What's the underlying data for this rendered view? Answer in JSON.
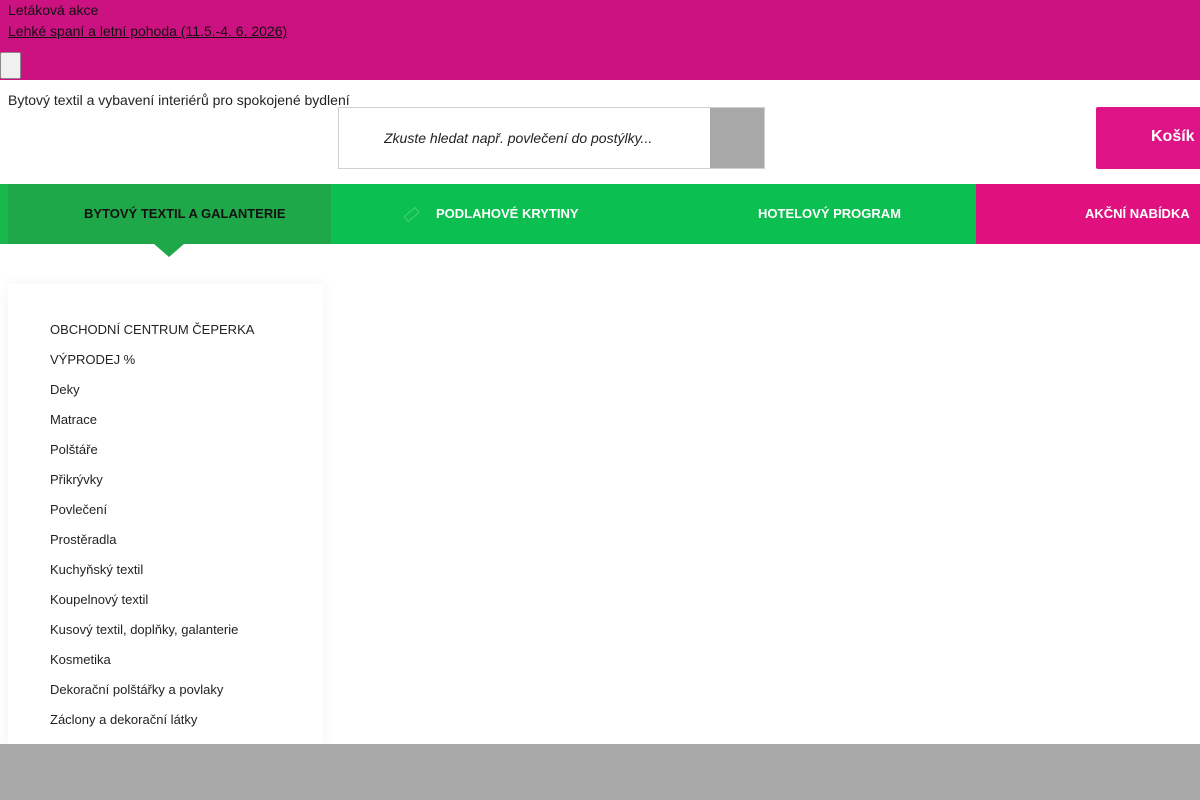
{
  "promo": {
    "title": "Letáková akce",
    "link_text": "Lehké spaní a letní pohoda (11.5.-4. 6. 2026)",
    "close_icon": "close-icon"
  },
  "header": {
    "logo_alt": "Bytový textil a vybavení interiérů pro spokojené bydlení",
    "search": {
      "placeholder": "Zkuste hledat např. povlečení do postýlky...",
      "value": "",
      "icon": "search-icon",
      "button_icon": "search-submit-icon",
      "icon_glyph": "",
      "button_glyph": ""
    },
    "cart": {
      "label": "Košík",
      "icon": "cart-icon",
      "icon_glyph": ""
    }
  },
  "nav": {
    "items": [
      {
        "label": "Bytový textil a galanterie",
        "icon": "home-icon",
        "glyph": "",
        "active": true
      },
      {
        "label": "Podlahové krytiny",
        "icon": "ruler-icon",
        "glyph": "▭"
      },
      {
        "label": "Hotelový program",
        "icon": "building-icon",
        "glyph": ""
      },
      {
        "label": "Akční nabídka",
        "icon": "",
        "glyph": ""
      }
    ]
  },
  "sidebar": {
    "items": [
      "OBCHODNÍ CENTRUM ČEPERKA",
      "VÝPRODEJ %",
      "Deky",
      "Matrace",
      "Polštáře",
      "Přikrývky",
      "Povlečení",
      "Prostěradla",
      "Kuchyňský textil",
      "Koupelnový textil",
      "Kusový textil, doplňky, galanterie",
      "Kosmetika",
      "Dekorační polštářky a povlaky",
      "Záclony a dekorační látky"
    ]
  },
  "colors": {
    "promo_bg": "#cc1180",
    "cart_bg": "#dd1386",
    "nav_active": "#1fa849",
    "nav_green": "#0bbf50",
    "nav_pink": "#e0117f"
  }
}
